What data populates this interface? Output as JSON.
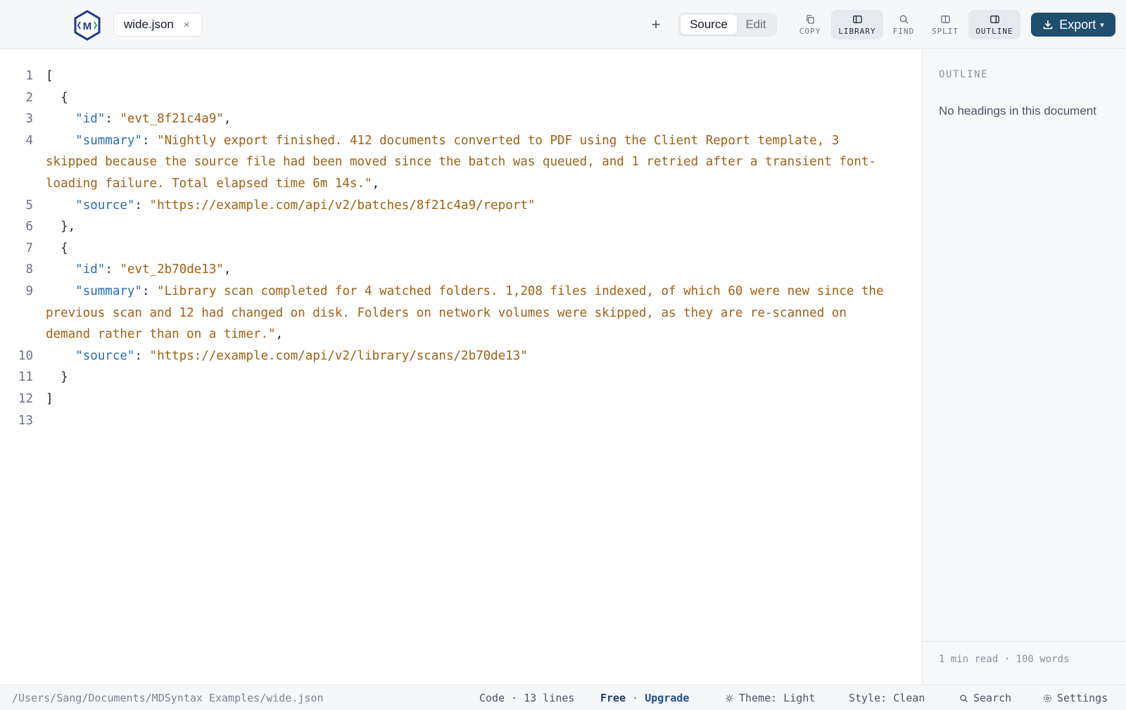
{
  "tab": {
    "filename": "wide.json",
    "close_glyph": "×"
  },
  "toolbar": {
    "new_tab_glyph": "+",
    "view_modes": [
      {
        "label": "Source",
        "active": true
      },
      {
        "label": "Edit",
        "active": false
      }
    ],
    "tools": [
      {
        "label": "COPY",
        "icon": "copy-icon",
        "active": false
      },
      {
        "label": "LIBRARY",
        "icon": "library-icon",
        "active": true
      },
      {
        "label": "FIND",
        "icon": "search-icon",
        "active": false
      },
      {
        "label": "SPLIT",
        "icon": "split-icon",
        "active": false
      },
      {
        "label": "OUTLINE",
        "icon": "outline-icon",
        "active": true
      }
    ],
    "export_label": "Export",
    "export_caret": "▾"
  },
  "editor": {
    "lines": [
      {
        "n": "1",
        "text": "["
      },
      {
        "n": "2",
        "text": "  {"
      },
      {
        "n": "3",
        "text": "    \"id\": \"evt_8f21c4a9\","
      },
      {
        "n": "4",
        "text": "    \"summary\": \"Nightly export finished. 412 documents converted to PDF using the Client Report template, 3\nskipped because the source file had been moved since the batch was queued, and 1 retried after a transient font-\nloading failure. Total elapsed time 6m 14s.\","
      },
      {
        "n": "5",
        "text": "    \"source\": \"https://example.com/api/v2/batches/8f21c4a9/report\""
      },
      {
        "n": "6",
        "text": "  },"
      },
      {
        "n": "7",
        "text": "  {"
      },
      {
        "n": "8",
        "text": "    \"id\": \"evt_2b70de13\","
      },
      {
        "n": "9",
        "text": "    \"summary\": \"Library scan completed for 4 watched folders. 1,208 files indexed, of which 60 were new since the\nprevious scan and 12 had changed on disk. Folders on network volumes were skipped, as they are re-scanned on\ndemand rather than on a timer.\","
      },
      {
        "n": "10",
        "text": "    \"source\": \"https://example.com/api/v2/library/scans/2b70de13\""
      },
      {
        "n": "11",
        "text": "  }"
      },
      {
        "n": "12",
        "text": "]"
      },
      {
        "n": "13",
        "text": ""
      }
    ]
  },
  "outline": {
    "title": "OUTLINE",
    "empty_message": "No headings in this document",
    "footer": "1 min read · 100 words"
  },
  "statusbar": {
    "path": "/Users/Sang/Documents/MDSyntax Examples/wide.json",
    "language": "Code · 13 lines",
    "plan_free": "Free",
    "plan_sep": " · ",
    "plan_upgrade": "Upgrade",
    "theme": "Theme: Light",
    "style": "Style: Clean",
    "search": "Search",
    "settings": "Settings"
  },
  "colors": {
    "accent": "#1e4f6e",
    "json_key": "#2b6cb0",
    "json_string": "#a06014"
  }
}
